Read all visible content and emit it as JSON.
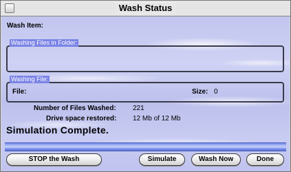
{
  "window": {
    "title": "Wash Status"
  },
  "wash_item": {
    "label": "Wash Item:"
  },
  "folder_group": {
    "title": "Washing Files in Folder:"
  },
  "file_group": {
    "title": "Washing File:",
    "file_label": "File:",
    "size_label": "Size:",
    "size_value": "0"
  },
  "stats": {
    "files_washed_label": "Number of Files Washed:",
    "files_washed_value": "221",
    "space_label": "Drive space restored:",
    "space_value": "12 Mb of 12 Mb"
  },
  "status": {
    "message": "Simulation Complete."
  },
  "progress": {
    "fraction": 1.0
  },
  "buttons": {
    "stop": "STOP the Wash",
    "simulate": "Simulate",
    "wash_now": "Wash Now",
    "done": "Done"
  },
  "colors": {
    "background_tint": "#c6c9f0",
    "group_title_bg": "#7b84e6",
    "progress_blue": "#7d93ea"
  }
}
